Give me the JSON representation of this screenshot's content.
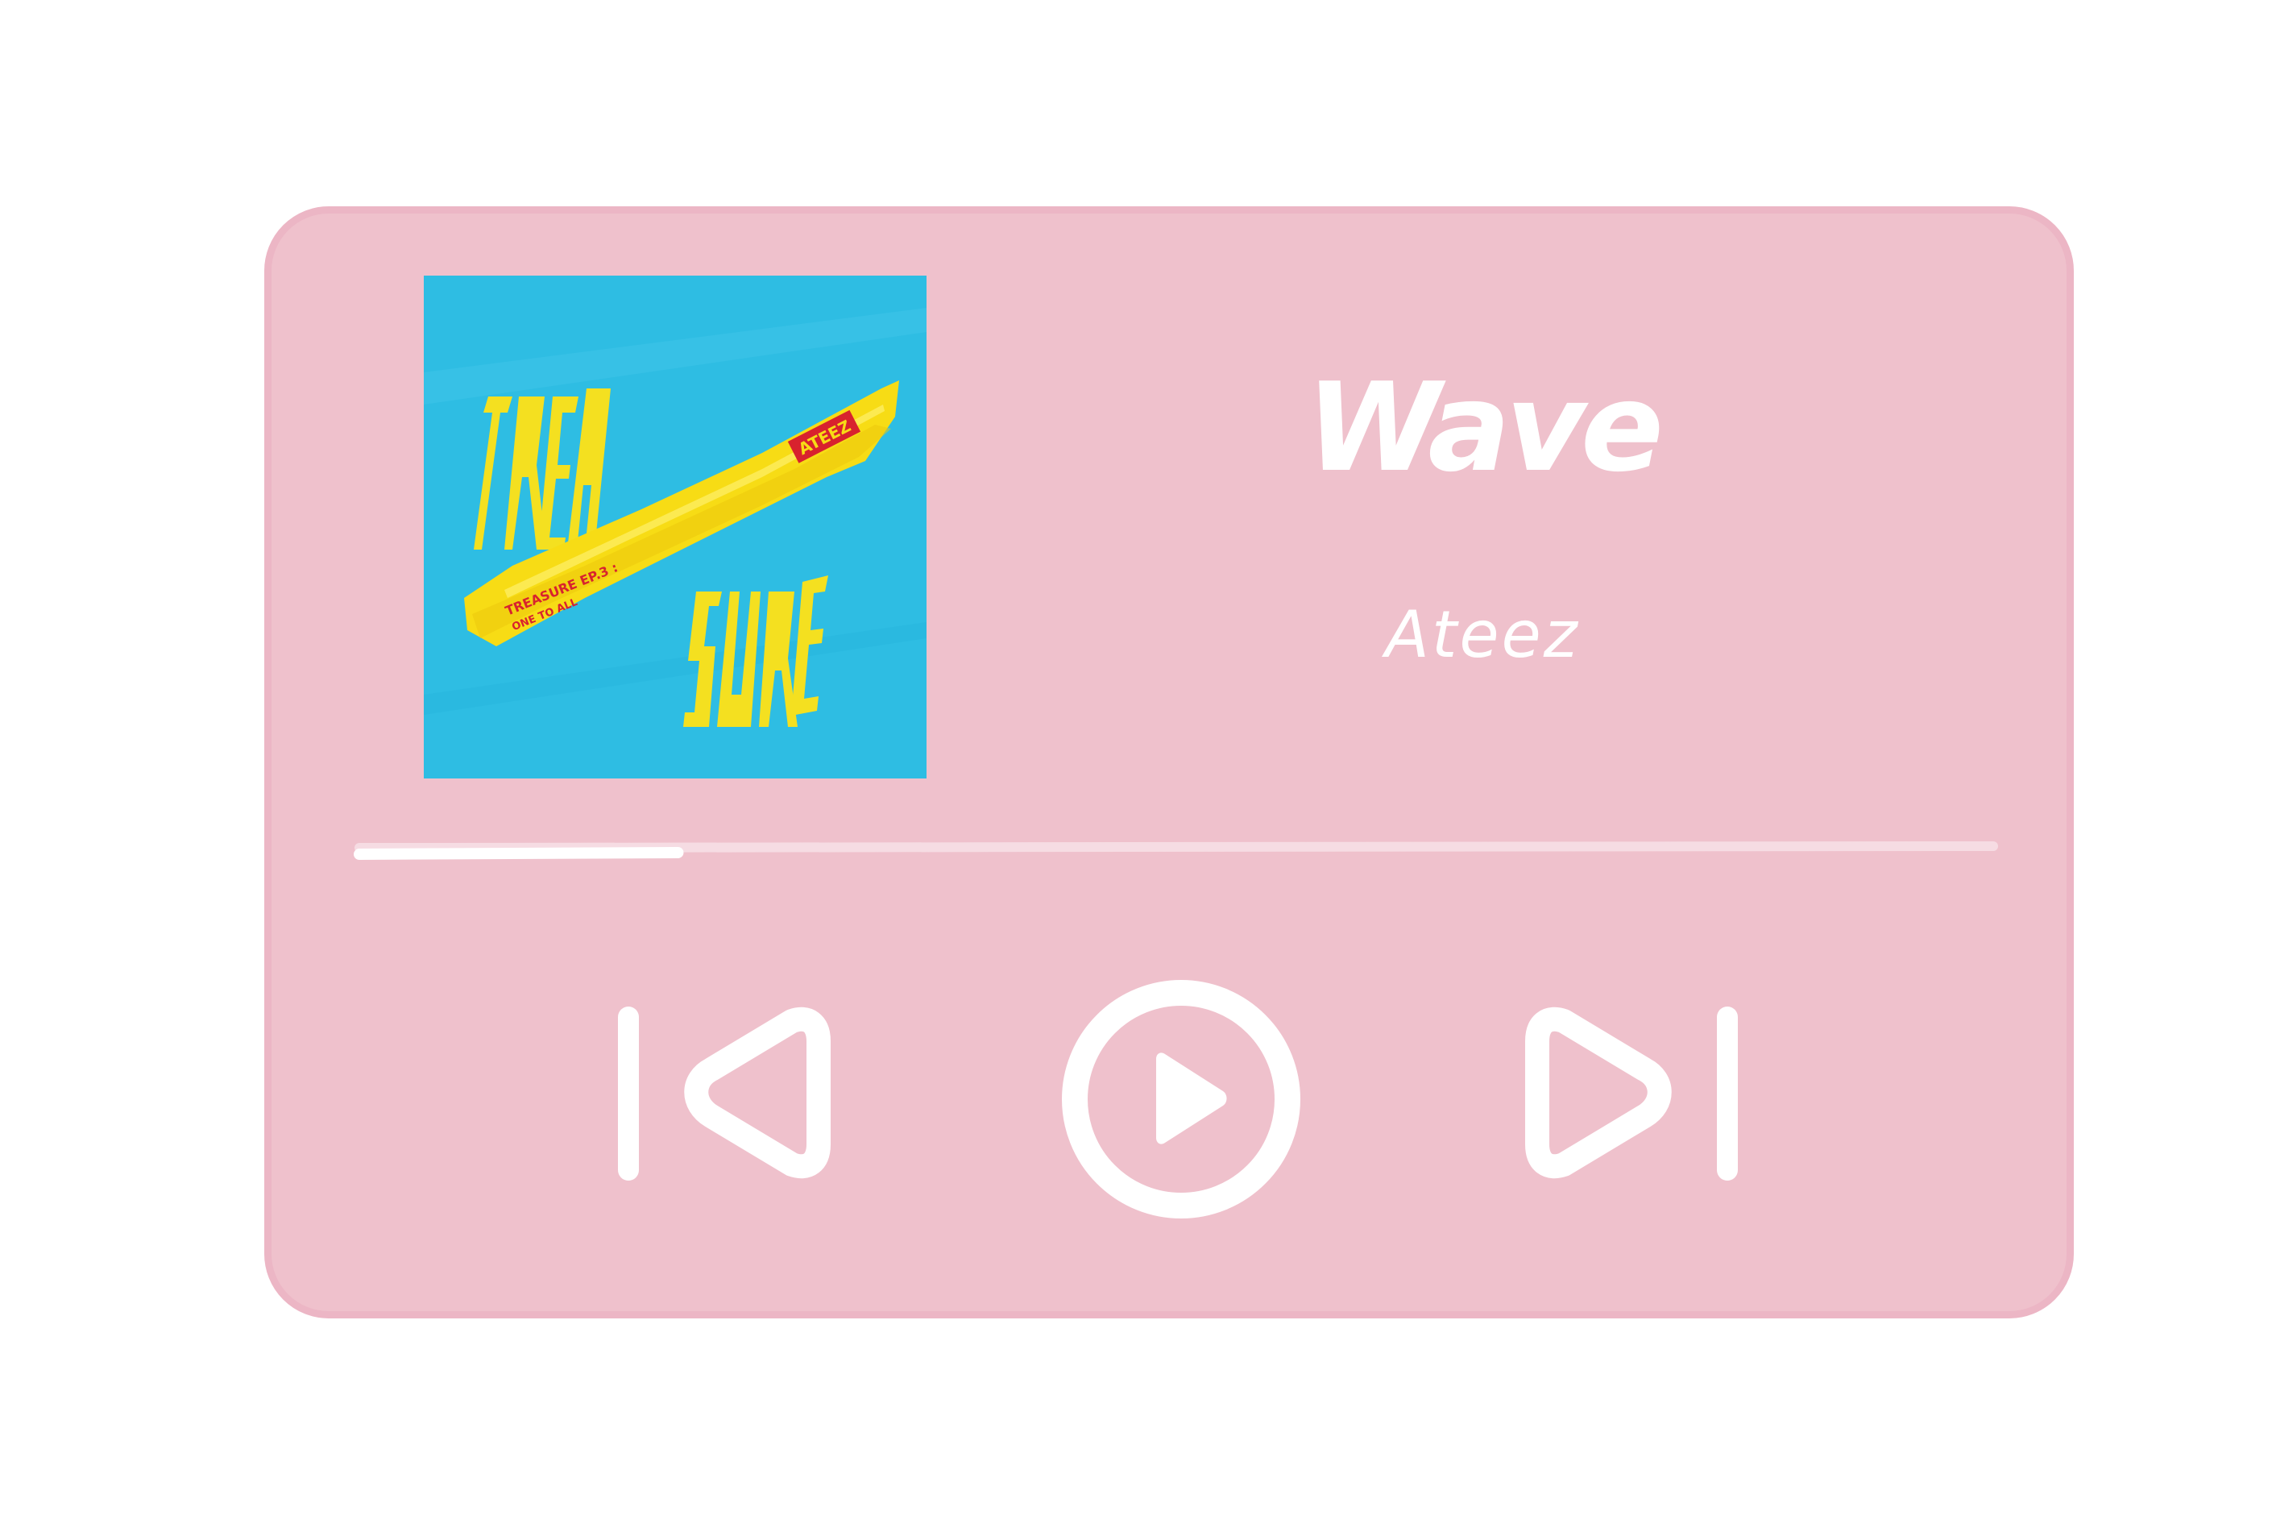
{
  "player": {
    "track": {
      "title": "Wave",
      "artist": "Ateez"
    },
    "album_art": {
      "band_label": "ATEEZ",
      "tape_text_line1": "TREASURE EP.3 :",
      "tape_text_line2": "ONE TO ALL",
      "colors": {
        "background": "#2ebde3",
        "tape": "#f7dc15",
        "lettering": "#f4e020",
        "label": "#d8222e"
      }
    },
    "progress": {
      "fraction": 0.195
    },
    "controls": {
      "previous": "skip-previous-icon",
      "play": "play-icon",
      "next": "skip-next-icon"
    }
  },
  "colors": {
    "card_background": "#efc1cc",
    "card_border": "#ecb6c5",
    "foreground": "#ffffff",
    "progress_track": "#f6dce3"
  }
}
